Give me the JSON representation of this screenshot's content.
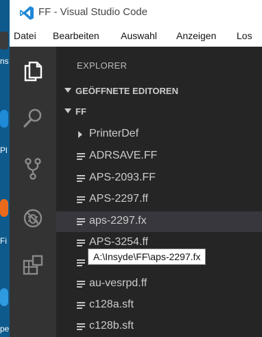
{
  "window": {
    "title": "FF - Visual Studio Code"
  },
  "menu": [
    "Datei",
    "Bearbeiten",
    "Auswahl",
    "Anzeigen",
    "Los"
  ],
  "desktop": {
    "labels": [
      "ns",
      "Pl",
      "Fi",
      "pe"
    ]
  },
  "explorer": {
    "title": "EXPLORER",
    "sections": [
      {
        "label": "GEÖFFNETE EDITOREN"
      },
      {
        "label": "FF"
      }
    ],
    "items": [
      {
        "name": "PrinterDef",
        "type": "folder"
      },
      {
        "name": "ADRSAVE.FF",
        "type": "file"
      },
      {
        "name": "APS-2093.FF",
        "type": "file"
      },
      {
        "name": "APS-2297.ff",
        "type": "file"
      },
      {
        "name": "aps-2297.fx",
        "type": "file",
        "selected": true
      },
      {
        "name": "APS-3254.ff",
        "type": "file"
      },
      {
        "name": "APS-3254.ff",
        "type": "file"
      },
      {
        "name": "au-vesrpd.ff",
        "type": "file"
      },
      {
        "name": "c128a.sft",
        "type": "file"
      },
      {
        "name": "c128b.sft",
        "type": "file"
      }
    ]
  },
  "tooltip": {
    "text": "A:\\Insyde\\FF\\aps-2297.fx"
  },
  "colors": {
    "activity_bar": "#333333",
    "sidebar": "#252526",
    "accent": "#0e7ad3"
  }
}
